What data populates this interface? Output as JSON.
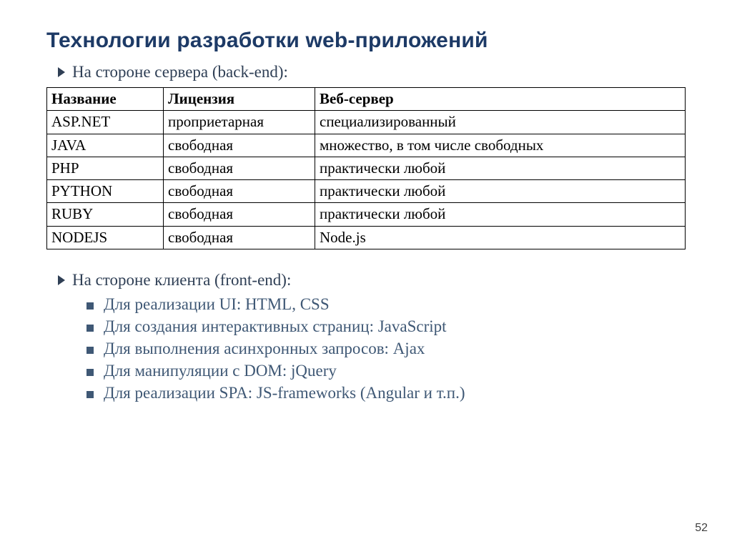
{
  "title": "Технологии разработки web-приложений",
  "section_backend": "На стороне сервера (back-end):",
  "table": {
    "headers": [
      "Название",
      "Лицензия",
      "Веб-сервер"
    ],
    "rows": [
      [
        "ASP.NET",
        "проприетарная",
        "специализированный"
      ],
      [
        "JAVA",
        "свободная",
        "множество, в том числе свободных"
      ],
      [
        "PHP",
        "свободная",
        "практически любой"
      ],
      [
        "PYTHON",
        "свободная",
        "практически любой"
      ],
      [
        "RUBY",
        "свободная",
        "практически любой"
      ],
      [
        "NODEJS",
        "свободная",
        "Node.js"
      ]
    ]
  },
  "section_frontend": "На стороне клиента (front-end):",
  "frontend_items": [
    "Для реализации UI: HTML, CSS",
    "Для создания интерактивных страниц: JavaScript",
    "Для выполнения асинхронных запросов: Ajax",
    "Для манипуляции с DOM: jQuery",
    "Для реализации SPA: JS-frameworks (Angular и т.п.)"
  ],
  "page_number": "52"
}
